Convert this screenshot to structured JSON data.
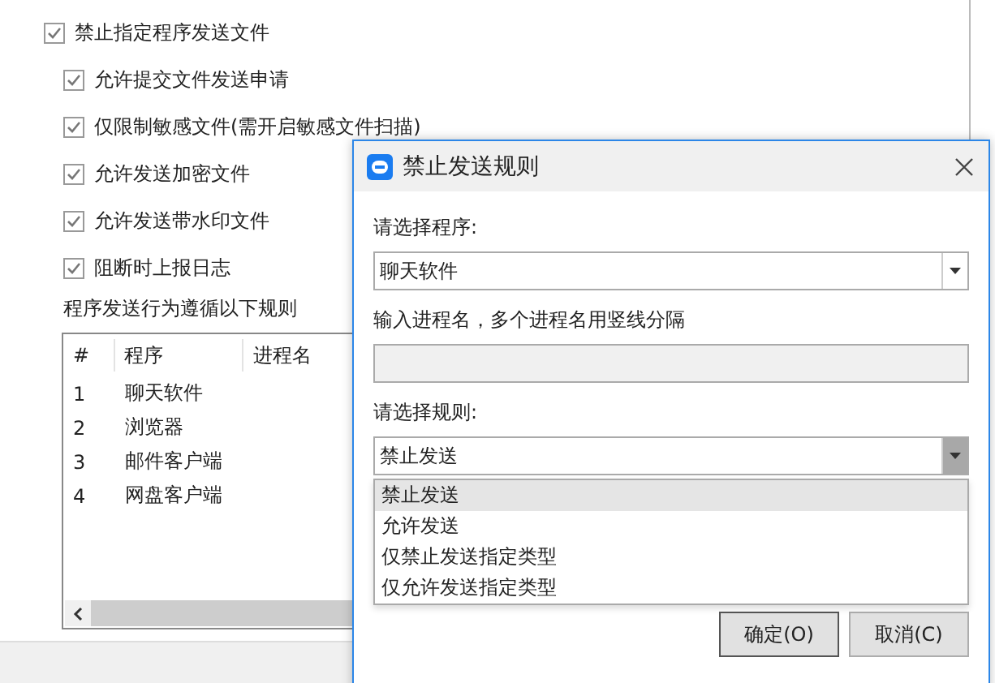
{
  "settings": {
    "main_option": {
      "label": "禁止指定程序发送文件",
      "checked": true
    },
    "sub_options": [
      {
        "label": "允许提交文件发送申请",
        "checked": true
      },
      {
        "label": "仅限制敏感文件(需开启敏感文件扫描)",
        "checked": true
      },
      {
        "label": "允许发送加密文件",
        "checked": true
      },
      {
        "label": "允许发送带水印文件",
        "checked": true
      },
      {
        "label": "阻断时上报日志",
        "checked": true
      }
    ],
    "rules_label": "程序发送行为遵循以下规则",
    "table": {
      "columns": [
        "#",
        "程序",
        "进程名"
      ],
      "rows": [
        [
          "1",
          "聊天软件"
        ],
        [
          "2",
          "浏览器"
        ],
        [
          "3",
          "邮件客户端"
        ],
        [
          "4",
          "网盘客户端"
        ]
      ]
    }
  },
  "dialog": {
    "title": "禁止发送规则",
    "program_label": "请选择程序:",
    "program_value": "聊天软件",
    "process_label": "输入进程名，多个进程名用竖线分隔",
    "rule_label": "请选择规则:",
    "rule_value": "禁止发送",
    "rule_open": true,
    "rule_options": [
      {
        "label": "禁止发送",
        "selected": true
      },
      {
        "label": "允许发送",
        "selected": false
      },
      {
        "label": "仅禁止发送指定类型",
        "selected": false
      },
      {
        "label": "仅允许发送指定类型",
        "selected": false
      }
    ],
    "buttons": [
      "确定(O)",
      "取消(C)"
    ]
  }
}
